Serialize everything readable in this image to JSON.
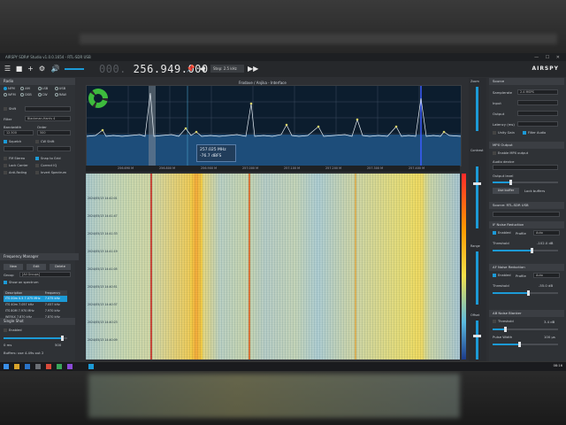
{
  "window": {
    "title": "AIRSPY SDR# Studio v1.0.0.1654 - RTL-SDR USB",
    "controls": "— ☐ ✕"
  },
  "toolbar": {
    "frequency_dim": "000.",
    "frequency": "256.949.000",
    "step": "Step: 2.5 kHz",
    "brand": "AIRSPY"
  },
  "spectrum": {
    "title": "Frodave / Anjika - Interface",
    "tooltip_freq": "257.025 MHz",
    "tooltip_level": "-76.7 dBFS",
    "ticks": [
      "256.690 M",
      "256.800 M",
      "256.900 M",
      "257.000 M",
      "257.100 M",
      "257.200 M",
      "257.300 M",
      "257.400 M",
      "257.500 M"
    ]
  },
  "waterfall": {
    "timestamps": [
      "2024/05/13 14:42:01",
      "2024/05/13 14:41:47",
      "2024/05/13 14:41:33",
      "2024/05/13 14:41:19",
      "2024/05/13 14:41:05",
      "2024/05/13 14:40:51",
      "2024/05/13 14:40:37",
      "2024/05/13 14:40:23",
      "2024/05/13 14:40:09",
      "2024/05/13 14:39:55"
    ]
  },
  "left": {
    "radio_title": "Radio",
    "modes": [
      "NFM",
      "AM",
      "LSB",
      "USB",
      "WFM",
      "DSB",
      "CW",
      "RAW"
    ],
    "shift_label": "Shift",
    "filter_label": "Filter",
    "filter_value": "Blackman-Harris 4",
    "bandwidth_label": "Bandwidth",
    "bandwidth_value": "12.500",
    "order_label": "Order",
    "order_value": "500",
    "squelch_label": "Squelch",
    "cw_label": "CW Shift",
    "snap_label": "Snap to Grid",
    "fm_label": "FM Stereo",
    "correct_label": "Correct IQ",
    "lock_label": "Lock Carrier",
    "antifading_label": "Anti-Fading",
    "invert_label": "Invert Spectrum",
    "fm_title": "Frequency Manager",
    "btn_new": "New",
    "btn_edit": "Edit",
    "btn_delete": "Delete",
    "group_label": "Group",
    "group_value": "[All Groups]",
    "show_spectrum": "Show on spectrum",
    "col_description": "Description",
    "col_frequency": "Frequency",
    "entries": [
      {
        "d": "ITS 00m 0.5 7.075 MHz",
        "f": "7.075 kHz",
        "sel": true
      },
      {
        "d": "ITS 40m 7.057 kHz",
        "f": "7.057 kHz"
      },
      {
        "d": "ITS 80M 7.970 MHz",
        "f": "7.970 kHz"
      },
      {
        "d": "WEFAX 7.870 kHz",
        "f": "7.870 kHz"
      },
      {
        "d": "HFCC 255.449 12:00",
        "f": "10.461 kHz"
      },
      {
        "d": "VE 0ev 5.735 MHz",
        "f": "5.735 kHz"
      },
      {
        "d": "PHSD 3 ukma 11.1",
        "f": "11.094 kHz"
      },
      {
        "d": "VL 455 W4L66T 1",
        "f": "11.175 kHz"
      }
    ],
    "audio_title": "Single Shot",
    "enabled_label": "Enabled",
    "min_label": "0 ms",
    "max_label": "500",
    "buffer_text": "Buffers: use 4.49s out 2"
  },
  "side": {
    "contrast_label": "Contrast",
    "range_label": "Range",
    "offset_label": "Offset",
    "zoom_label": "Zoom"
  },
  "right": {
    "source_title": "Source",
    "samplerate_label": "Samplerate",
    "samplerate_value": "2.4 MSPS",
    "input_label": "Input",
    "output_label": "Output",
    "latency_label": "Latency (ms)",
    "unity_label": "Unity Gain",
    "filter_audio_label": "Filter Audio",
    "mpx_title": "MPX Output",
    "enable_mpx": "Enable MPX output",
    "audio_device_label": "Audio device",
    "output_level_label": "Output level",
    "use_buffer_label": "Use buffer",
    "lock_buffers_label": "Lock buffers",
    "source2_title": "Source: RTL-SDR USB",
    "if_title": "IF Noise Reduction",
    "enabled_label": "Enabled",
    "profile_label": "Profile",
    "profile_value": "Auto",
    "threshold_label": "Threshold",
    "threshold_value": "-102.0 dB",
    "af_title": "AF Noise Reduction",
    "af_threshold_value": "-55.0 dB",
    "ab_title": "AB Noise Blanker",
    "noise_threshold_label": "Threshold",
    "noise_threshold_value": "3.4 dB",
    "pulse_width_label": "Pulse Width",
    "pulse_width_value": "100 µs"
  },
  "taskbar": {
    "clock": "08:16"
  }
}
